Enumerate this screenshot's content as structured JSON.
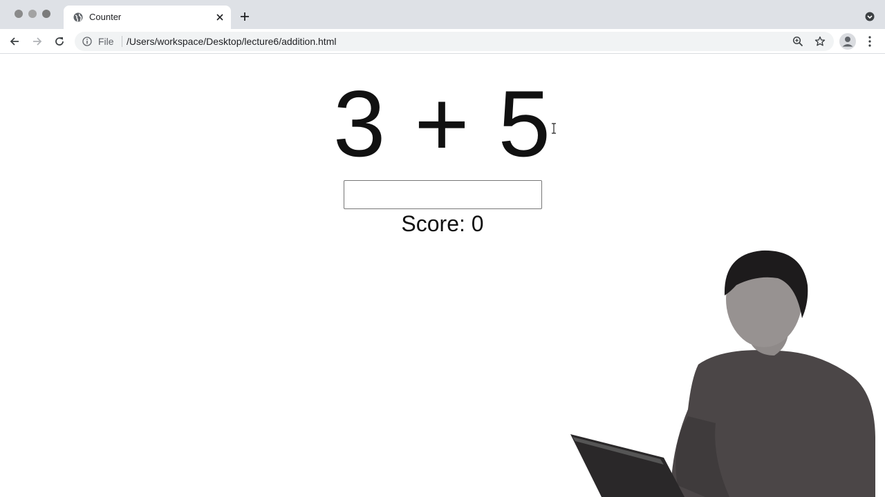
{
  "browser": {
    "tab": {
      "title": "Counter"
    },
    "address": {
      "scheme_label": "File",
      "url": "/Users/workspace/Desktop/lecture6/addition.html"
    }
  },
  "page": {
    "problem": "3 + 5",
    "answer": {
      "value": "",
      "placeholder": ""
    },
    "score": {
      "label": "Score:",
      "value": "0"
    }
  },
  "icons": {
    "tab": "globe-icon",
    "close": "close-icon",
    "new_tab": "plus-icon",
    "back": "back-arrow-icon",
    "forward": "forward-arrow-icon",
    "reload": "reload-icon",
    "info": "info-icon",
    "zoom": "zoom-icon",
    "bookmark": "star-icon",
    "profile": "profile-icon",
    "tab_search": "tab-search-icon"
  },
  "colors": {
    "tabstrip": "#dee1e6",
    "omnibox": "#f1f3f4",
    "text": "#111111"
  }
}
